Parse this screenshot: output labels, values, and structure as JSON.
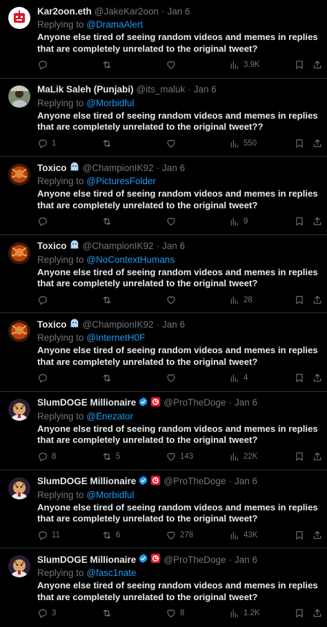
{
  "tweets": [
    {
      "name": "Kar2oon.eth",
      "handle": "@JakeKar2oon",
      "date": "Jan 6",
      "replying_label": "Replying to",
      "replying_to": "@DramaAlert",
      "text": "Anyone else tired of seeing random videos and memes in replies that are completely unrelated to the original tweet?",
      "replies": "",
      "retweets": "",
      "likes": "",
      "views": "3.9K",
      "avatar": "red-robot",
      "verified": false,
      "emoji": false,
      "flag": false
    },
    {
      "name": "MaLik Saleh (Punjabi)",
      "handle": "@its_maluk",
      "date": "Jan 6",
      "replying_label": "Replying to",
      "replying_to": "@Morbidful",
      "text": "Anyone else tired of seeing random videos and memes in replies that are completely unrelated to the original tweet??",
      "replies": "1",
      "retweets": "",
      "likes": "",
      "views": "550",
      "avatar": "person-photo",
      "verified": false,
      "emoji": false,
      "flag": false
    },
    {
      "name": "Toxico",
      "handle": "@ChampionIK92",
      "date": "Jan 6",
      "replying_label": "Replying to",
      "replying_to": "@PicturesFolder",
      "text": "Anyone else tired of seeing random videos and memes in replies that are completely unrelated to the original tweet?",
      "replies": "",
      "retweets": "",
      "likes": "",
      "views": "9",
      "avatar": "orange-character",
      "verified": false,
      "emoji": true,
      "flag": false
    },
    {
      "name": "Toxico",
      "handle": "@ChampionIK92",
      "date": "Jan 6",
      "replying_label": "Replying to",
      "replying_to": "@NoContextHumans",
      "text": "Anyone else tired of seeing random videos and memes in replies that are completely unrelated to the original tweet?",
      "replies": "",
      "retweets": "",
      "likes": "",
      "views": "28",
      "avatar": "orange-character",
      "verified": false,
      "emoji": true,
      "flag": false
    },
    {
      "name": "Toxico",
      "handle": "@ChampionIK92",
      "date": "Jan 6",
      "replying_label": "Replying to",
      "replying_to": "@InternetH0F",
      "text": "Anyone else tired of seeing random videos and memes in replies that are completely unrelated to the original tweet?",
      "replies": "",
      "retweets": "",
      "likes": "",
      "views": "4",
      "avatar": "orange-character",
      "verified": false,
      "emoji": true,
      "flag": false
    },
    {
      "name": "SlumDOGE Millionaire",
      "handle": "@ProTheDoge",
      "date": "Jan 6",
      "replying_label": "Replying to",
      "replying_to": "@Enezator",
      "text": "Anyone else tired of seeing random videos and memes in replies that are completely unrelated to the original tweet?",
      "replies": "8",
      "retweets": "5",
      "likes": "143",
      "views": "22K",
      "avatar": "doge-cartoon",
      "verified": true,
      "emoji": false,
      "flag": true
    },
    {
      "name": "SlumDOGE Millionaire",
      "handle": "@ProTheDoge",
      "date": "Jan 6",
      "replying_label": "Replying to",
      "replying_to": "@Morbidful",
      "text": "Anyone else tired of seeing random videos and memes in replies that are completely unrelated to the original tweet?",
      "replies": "11",
      "retweets": "6",
      "likes": "278",
      "views": "43K",
      "avatar": "doge-cartoon",
      "verified": true,
      "emoji": false,
      "flag": true
    },
    {
      "name": "SlumDOGE Millionaire",
      "handle": "@ProTheDoge",
      "date": "Jan 6",
      "replying_label": "Replying to",
      "replying_to": "@fasc1nate",
      "text": "Anyone else tired of seeing random videos and memes in replies that are completely unrelated to the original tweet?",
      "replies": "3",
      "retweets": "",
      "likes": "8",
      "views": "1.2K",
      "avatar": "doge-cartoon",
      "verified": true,
      "emoji": false,
      "flag": true
    }
  ],
  "dot": "·",
  "colors": {
    "background": "#000000",
    "text": "#e7e9ea",
    "muted": "#71767b",
    "link": "#1d9bf0",
    "divider": "#2f3336"
  }
}
